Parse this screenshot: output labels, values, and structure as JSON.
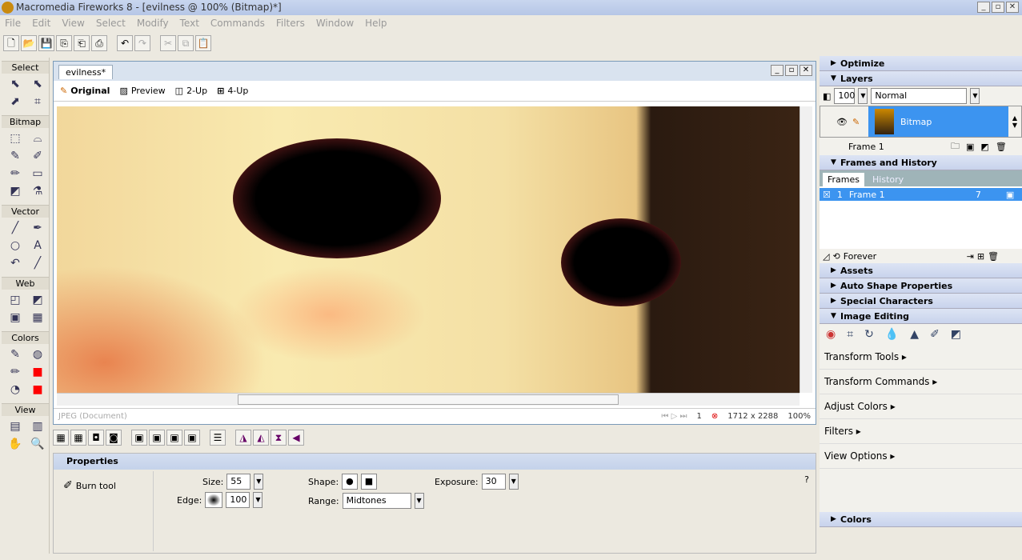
{
  "window": {
    "title": "Macromedia Fireworks 8 - [evilness @ 100% (Bitmap)*]"
  },
  "menu": [
    "File",
    "Edit",
    "View",
    "Select",
    "Modify",
    "Text",
    "Commands",
    "Filters",
    "Window",
    "Help"
  ],
  "toolbar": [
    "new-icon",
    "open-icon",
    "save-icon",
    "import-icon",
    "export-icon",
    "print-icon",
    "undo-icon",
    "redo-icon",
    "cut-icon",
    "copy-icon",
    "paste-icon"
  ],
  "tools": {
    "sections": [
      {
        "label": "Select",
        "icons": [
          "⬉",
          "⬉",
          "⬈",
          "⌗"
        ]
      },
      {
        "label": "Bitmap",
        "icons": [
          "⬚",
          "⌓",
          "✎",
          "✐",
          "✏",
          "▭",
          "◩",
          "⚗"
        ]
      },
      {
        "label": "Vector",
        "icons": [
          "╱",
          "✒",
          "○",
          "A",
          "↶",
          "╱"
        ]
      },
      {
        "label": "Web",
        "icons": [
          "◰",
          "◩",
          "▣",
          "▦"
        ]
      },
      {
        "label": "Colors",
        "icons": [
          "✎",
          "◍",
          "✏",
          "■",
          "◔",
          "■"
        ]
      },
      {
        "label": "View",
        "icons": [
          "▤",
          "▥",
          "✋",
          "🔍"
        ]
      }
    ],
    "stroke_color": "#ff0000",
    "fill_color": "#ff0000"
  },
  "document": {
    "tab": "evilness*",
    "views": [
      "Original",
      "Preview",
      "2-Up",
      "4-Up"
    ],
    "status": "JPEG (Document)",
    "frame": "1",
    "size": "1712 x 2288",
    "zoom": "100%"
  },
  "properties": {
    "title": "Properties",
    "tool": "Burn tool",
    "size_label": "Size:",
    "size": "55",
    "edge_label": "Edge:",
    "edge": "100",
    "shape_label": "Shape:",
    "range_label": "Range:",
    "range": "Midtones",
    "exposure_label": "Exposure:",
    "exposure": "30"
  },
  "panels": {
    "optimize": "Optimize",
    "layers": "Layers",
    "opacity": "100",
    "blend": "Normal",
    "layer_name": "Bitmap",
    "frame_label": "Frame 1",
    "frames_history": "Frames and History",
    "tab_frames": "Frames",
    "tab_history": "History",
    "frame_row_num": "1",
    "frame_row_name": "Frame 1",
    "frame_row_delay": "7",
    "loop": "Forever",
    "assets": "Assets",
    "auto_shape": "Auto Shape Properties",
    "special_chars": "Special Characters",
    "image_editing": "Image Editing",
    "items": [
      "Transform Tools",
      "Transform Commands",
      "Adjust Colors",
      "Filters",
      "View Options"
    ],
    "colors": "Colors"
  },
  "colors": {
    "accent": "#3c94f0"
  }
}
